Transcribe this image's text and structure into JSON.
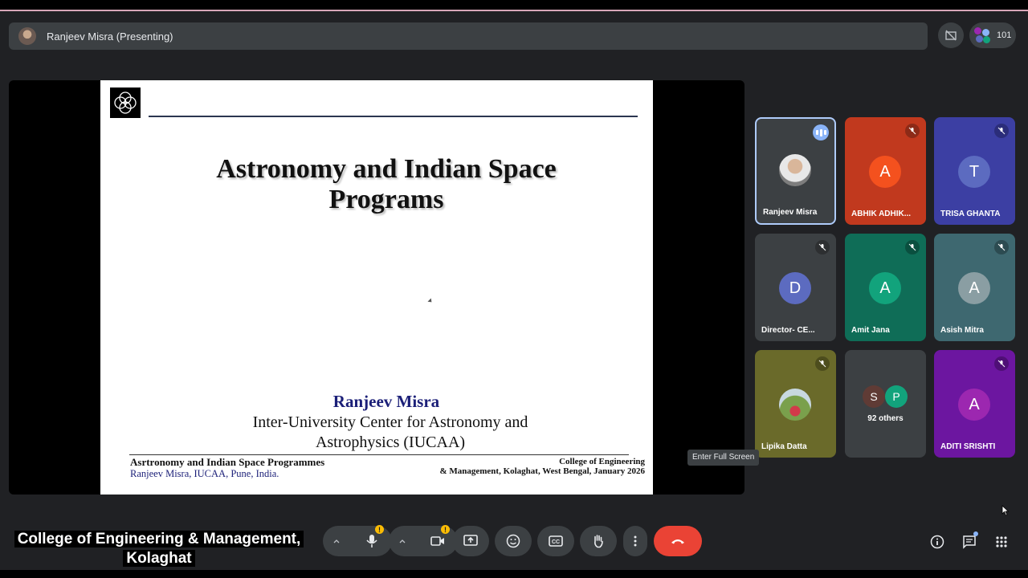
{
  "topbar": {
    "title": "Ranjeev Misra (Presenting)",
    "participant_count": "101"
  },
  "slide": {
    "title": "Astronomy and Indian Space Programs",
    "author": "Ranjeev Misra",
    "affiliation_line1": "Inter-University Center for Astronomy and",
    "affiliation_line2": "Astrophysics (IUCAA)",
    "footer_left_title": "Asrtronomy and Indian Space Programmes",
    "footer_left_author": "Ranjeev Misra, IUCAA, Pune, India.",
    "footer_right_line1": "College of Engineering",
    "footer_right_line2": "& Management, Kolaghat, West Bengal,  January 2026"
  },
  "tiles": [
    {
      "name": "Ranjeev Misra",
      "initial": "",
      "color": "#3c4043",
      "avatar_color": "#cccccc"
    },
    {
      "name": "ABHIK ADHIK...",
      "initial": "A",
      "color": "#c1391e",
      "avatar_color": "#f4511e"
    },
    {
      "name": "TRISA GHANTA",
      "initial": "T",
      "color": "#3c3fa3",
      "avatar_color": "#5c6bc0"
    },
    {
      "name": "Director- CE...",
      "initial": "D",
      "color": "#3c4043",
      "avatar_color": "#5c6bc0"
    },
    {
      "name": "Amit Jana",
      "initial": "A",
      "color": "#0f6d57",
      "avatar_color": "#12a37c"
    },
    {
      "name": "Asish Mitra",
      "initial": "A",
      "color": "#3e6870",
      "avatar_color": "#8a9ea3"
    },
    {
      "name": "Lipika Datta",
      "initial": "",
      "color": "#6a6a2a",
      "avatar_color": "#aab080"
    },
    {
      "name": "92 others",
      "initial": "",
      "color": "#3c4043",
      "avatar_color": "#3c4043"
    },
    {
      "name": "ADITI SRISHTI",
      "initial": "A",
      "color": "#6c16a0",
      "avatar_color": "#9c27b0"
    }
  ],
  "others_initials": [
    "S",
    "P"
  ],
  "tooltip": "Enter Full Screen",
  "caption": {
    "line1": "College of Engineering & Management,",
    "line2": "Kolaghat"
  },
  "warning_mark": "!",
  "colors": {
    "end_call": "#ea4335",
    "warning": "#fbbc04",
    "speaking": "#8ab4f8"
  }
}
